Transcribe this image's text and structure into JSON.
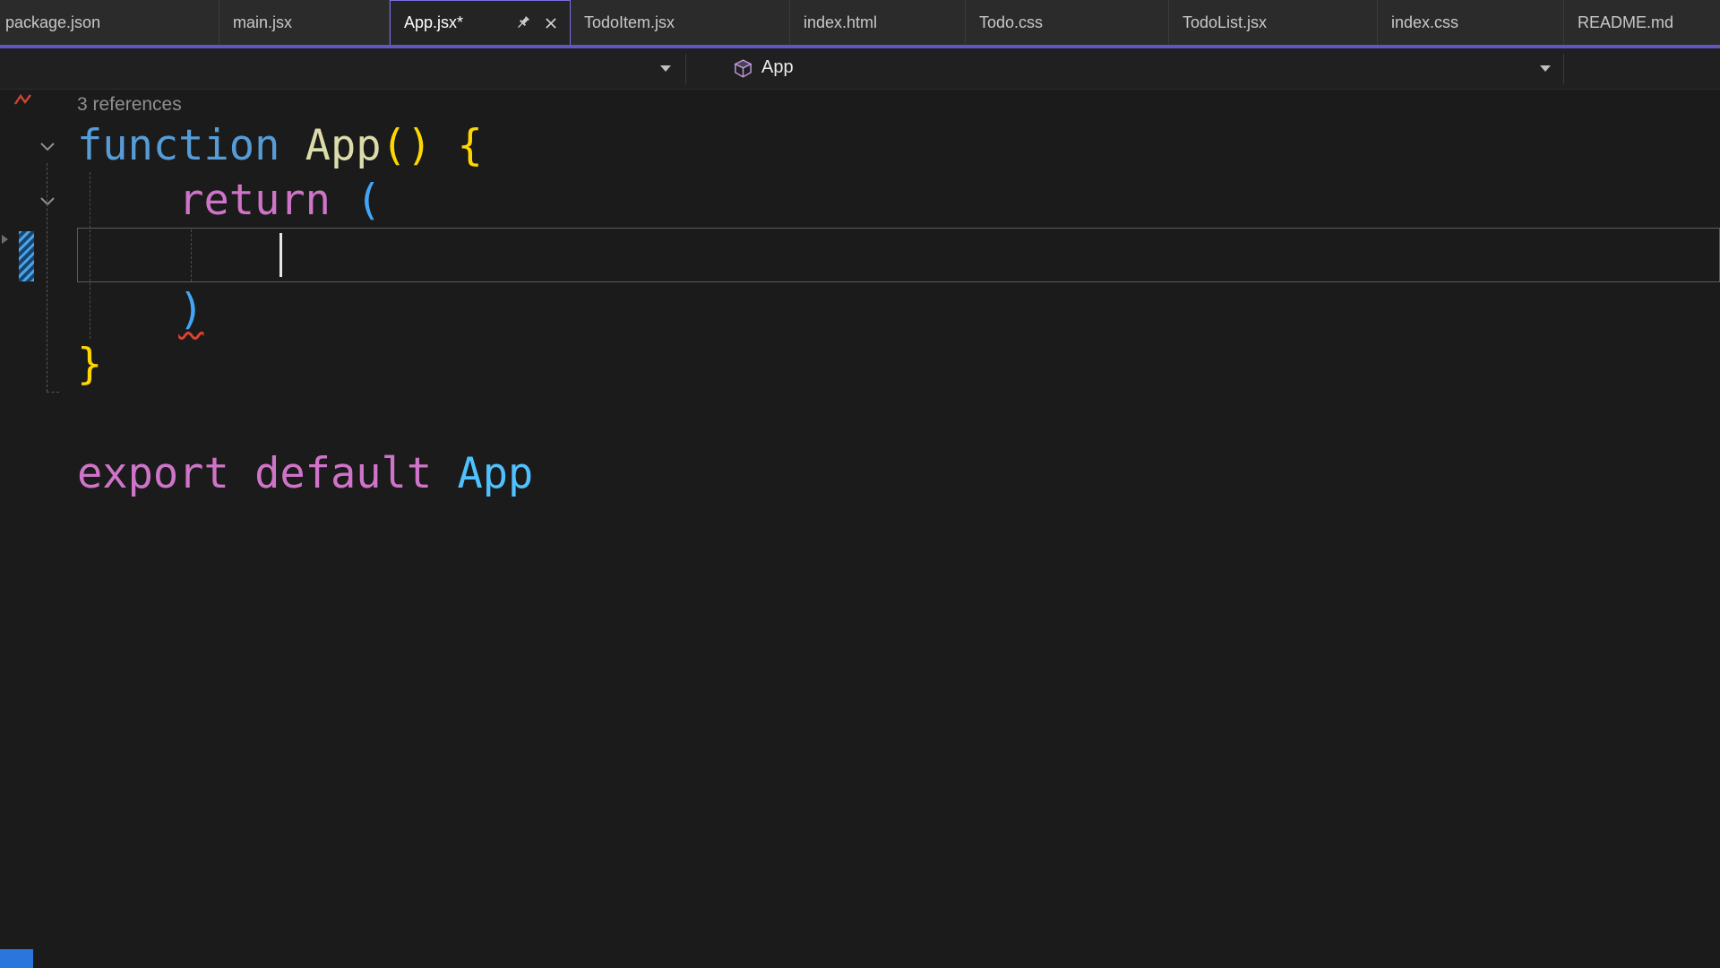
{
  "colors": {
    "accent_purple": "#6057c0",
    "accent_purple_bright": "#7a6fe0",
    "editor_bg": "#1b1b1b",
    "tabbar_bg": "#2b2b2b",
    "navbar_bg": "#202021",
    "codelens_text": "#8f8f8f",
    "squiggle_red": "#e0402e",
    "change_marker_blue": "#4aa3e8",
    "statusbar_blue": "#2a76dd",
    "syntax": {
      "keyword": "#569cd6",
      "control": "#cf74c8",
      "func": "#dcdcaa",
      "gold": "#ffd700",
      "bracket": "#42a5f5",
      "ident": "#4fc1ff",
      "plain": "#d4d4d4"
    }
  },
  "tabs": {
    "items": [
      {
        "label": "package.json",
        "active": false
      },
      {
        "label": "main.jsx",
        "active": false
      },
      {
        "label": "App.jsx*",
        "active": true,
        "pinned": true,
        "closable": true
      },
      {
        "label": "TodoItem.jsx",
        "active": false
      },
      {
        "label": "index.html",
        "active": false
      },
      {
        "label": "Todo.css",
        "active": false
      },
      {
        "label": "TodoList.jsx",
        "active": false
      },
      {
        "label": "index.css",
        "active": false
      },
      {
        "label": "README.md",
        "active": false
      }
    ]
  },
  "navbar": {
    "member_label": "App"
  },
  "editor": {
    "codelens_label": "3 references",
    "selected_line": 2,
    "cursor": {
      "line": 2,
      "col": 8
    },
    "lines": [
      {
        "tokens": [
          {
            "t": "function",
            "c": "keyword"
          },
          {
            "t": " ",
            "c": "plain"
          },
          {
            "t": "App",
            "c": "func"
          },
          {
            "t": "()",
            "c": "gold"
          },
          {
            "t": " ",
            "c": "plain"
          },
          {
            "t": "{",
            "c": "gold"
          }
        ]
      },
      {
        "tokens": [
          {
            "t": "    ",
            "c": "plain"
          },
          {
            "t": "return",
            "c": "control"
          },
          {
            "t": " ",
            "c": "plain"
          },
          {
            "t": "(",
            "c": "bracket"
          }
        ]
      },
      {
        "tokens": []
      },
      {
        "tokens": [
          {
            "t": "    ",
            "c": "plain"
          },
          {
            "t": ")",
            "c": "bracket",
            "squiggle": true
          }
        ]
      },
      {
        "tokens": [
          {
            "t": "}",
            "c": "gold"
          }
        ]
      },
      {
        "tokens": []
      },
      {
        "tokens": [
          {
            "t": "export",
            "c": "control"
          },
          {
            "t": " ",
            "c": "plain"
          },
          {
            "t": "default",
            "c": "control"
          },
          {
            "t": " ",
            "c": "plain"
          },
          {
            "t": "App",
            "c": "ident"
          }
        ]
      }
    ]
  }
}
